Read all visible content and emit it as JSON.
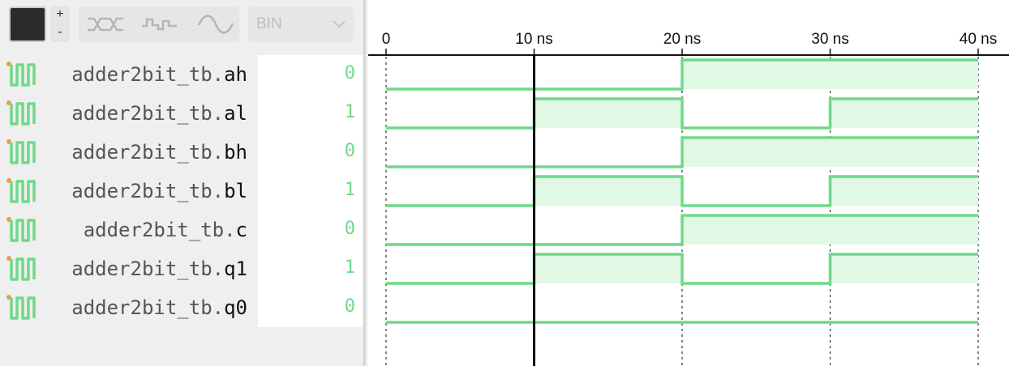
{
  "toolbar": {
    "zoom_in_label": "+",
    "zoom_out_label": "-",
    "tools": [
      "bus-format-icon",
      "step-format-icon",
      "analog-format-icon"
    ],
    "radix": "BIN",
    "swatch_color": "#2b2b2b"
  },
  "colors": {
    "wave": "#6fd989",
    "wave_fill": "#e1f8e4",
    "cursor": "#000000",
    "value": "#6fd989"
  },
  "signals": [
    {
      "prefix": "adder2bit_tb.",
      "leaf": "ah",
      "value": "0"
    },
    {
      "prefix": "adder2bit_tb.",
      "leaf": "al",
      "value": "1"
    },
    {
      "prefix": "adder2bit_tb.",
      "leaf": "bh",
      "value": "0"
    },
    {
      "prefix": "adder2bit_tb.",
      "leaf": "bl",
      "value": "1"
    },
    {
      "prefix": "adder2bit_tb.",
      "leaf": "c",
      "value": "0"
    },
    {
      "prefix": "adder2bit_tb.",
      "leaf": "q1",
      "value": "1"
    },
    {
      "prefix": "adder2bit_tb.",
      "leaf": "q0",
      "value": "0"
    }
  ],
  "timeline": {
    "ticks": [
      "0",
      "10 ns",
      "20 ns",
      "30 ns",
      "40 ns"
    ],
    "tick_times_ns": [
      0,
      10,
      20,
      30,
      40
    ],
    "cursor_time_ns": 10
  },
  "waveforms": [
    [
      [
        0,
        0
      ],
      [
        20,
        1
      ],
      [
        40,
        1
      ]
    ],
    [
      [
        0,
        0
      ],
      [
        10,
        1
      ],
      [
        20,
        0
      ],
      [
        30,
        1
      ],
      [
        40,
        1
      ]
    ],
    [
      [
        0,
        0
      ],
      [
        20,
        1
      ],
      [
        40,
        1
      ]
    ],
    [
      [
        0,
        0
      ],
      [
        10,
        1
      ],
      [
        20,
        0
      ],
      [
        30,
        1
      ],
      [
        40,
        1
      ]
    ],
    [
      [
        0,
        0
      ],
      [
        20,
        1
      ],
      [
        40,
        1
      ]
    ],
    [
      [
        0,
        0
      ],
      [
        10,
        1
      ],
      [
        20,
        0
      ],
      [
        30,
        1
      ],
      [
        40,
        1
      ]
    ],
    [
      [
        0,
        0
      ],
      [
        40,
        0
      ]
    ]
  ]
}
